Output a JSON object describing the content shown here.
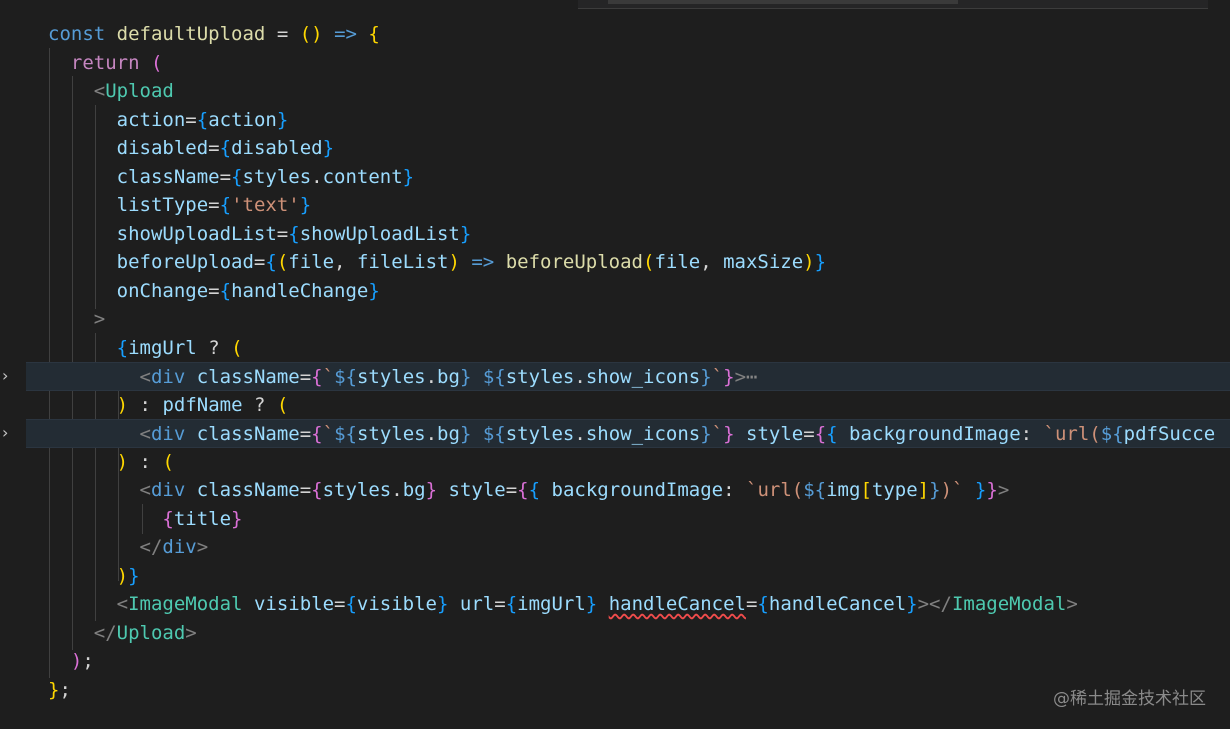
{
  "code_lines": [
    "const defaultUpload = () => {",
    "  return (",
    "    <Upload",
    "      action={action}",
    "      disabled={disabled}",
    "      className={styles.content}",
    "      listType={'text'}",
    "      showUploadList={showUploadList}",
    "      beforeUpload={(file, fileList) => beforeUpload(file, maxSize)}",
    "      onChange={handleChange}",
    "    >",
    "      {imgUrl ? (",
    "        <div className={`${styles.bg} ${styles.show_icons}`}>⋯",
    "      ) : pdfName ? (",
    "        <div className={`${styles.bg} ${styles.show_icons}`} style={{ backgroundImage: `url(${pdfSucce",
    "      ) : (",
    "        <div className={styles.bg} style={{ backgroundImage: `url(${img[type]})` }}>",
    "          {title}",
    "        </div>",
    "      )}",
    "      <ImageModal visible={visible} url={imgUrl} handleCancel={handleCancel}></ImageModal>",
    "    </Upload>",
    "  );",
    "};"
  ],
  "watermark": "@稀土掘金技术社区",
  "colors": {
    "background": "#1e1e1e",
    "keyword": "#569cd6",
    "control": "#c586c0",
    "function": "#dcdcaa",
    "variable": "#9cdcfe",
    "tag": "#4ec9b0",
    "string": "#ce9178"
  },
  "icons": {
    "fold_marker": "chevron-right-icon"
  }
}
